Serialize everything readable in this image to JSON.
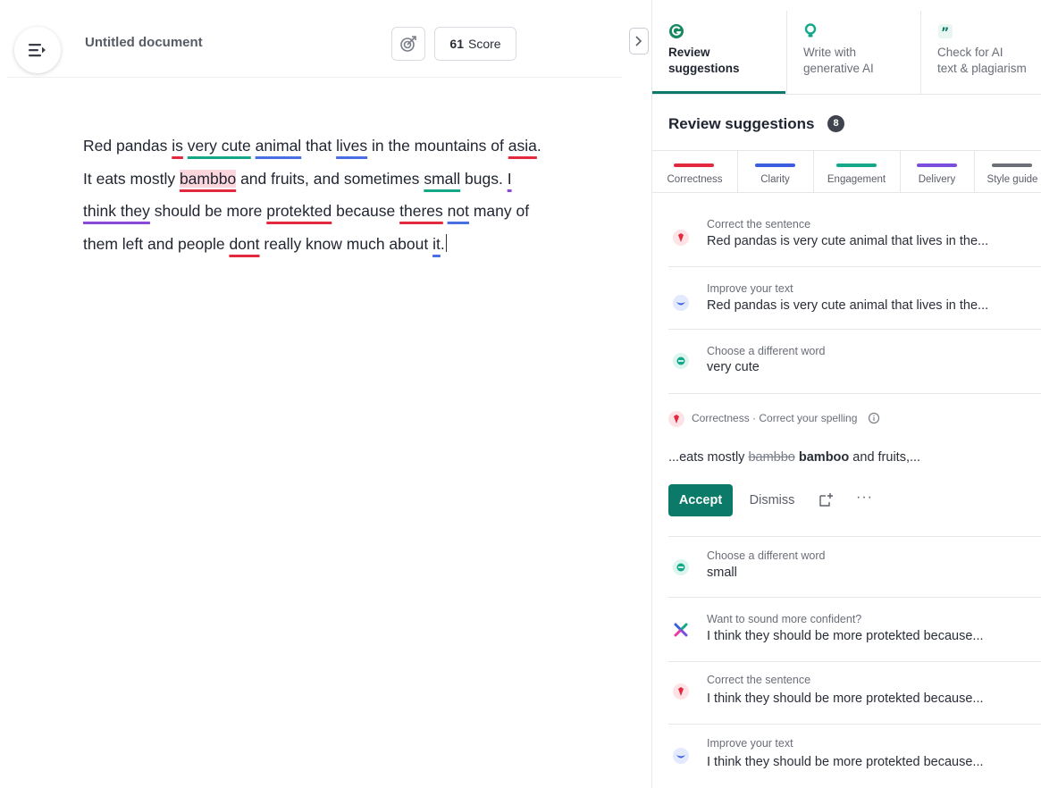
{
  "editor": {
    "doc_title": "Untitled document",
    "score": {
      "value": "61",
      "label": "Score"
    },
    "text": {
      "s1": "Red pandas ",
      "w_is": "is",
      "s2": " ",
      "w_very_cute": "very cute",
      "s3": " ",
      "w_animal": "animal",
      "s4": " that ",
      "w_lives": "lives",
      "s5": " in the mountains of ",
      "w_asia": "asia",
      "s6": ".",
      "s7": "It eats mostly ",
      "w_bambbo": "bambbo",
      "s8": " and fruits, and sometimes ",
      "w_small": "small",
      "s9": " bugs. ",
      "w_i": "I",
      "w_think_they": "think they",
      "s10": " should be more ",
      "w_protekted": "protekted",
      "s11": " because ",
      "w_theres": "theres",
      "s12": " ",
      "w_not": "not",
      "s13": " many of",
      "s14": "them left and people ",
      "w_dont": "dont",
      "s15": " really know much about ",
      "w_it": "it",
      "s16": "."
    }
  },
  "panel": {
    "tabs": [
      {
        "label": "Review\nsuggestions",
        "icon": "grammarly-g-icon"
      },
      {
        "label": "Write with\ngenerative AI",
        "icon": "lightbulb-icon"
      },
      {
        "label": "Check for AI\ntext & plagiarism",
        "icon": "quote-icon"
      }
    ],
    "header": "Review suggestions",
    "count": "8",
    "categories": [
      {
        "label": "Correctness",
        "color": "#e22a3f"
      },
      {
        "label": "Clarity",
        "color": "#3b5ee0"
      },
      {
        "label": "Engagement",
        "color": "#14a889"
      },
      {
        "label": "Delivery",
        "color": "#7c4ee0"
      },
      {
        "label": "Style guide",
        "color": "#6b6f78"
      }
    ],
    "cards": [
      {
        "title": "Correct the sentence",
        "text": "Red pandas is very cute animal that lives in the...",
        "kind": "correctness"
      },
      {
        "title": "Improve your text",
        "text": "Red pandas is very cute animal that lives in the...",
        "kind": "clarity"
      },
      {
        "title": "Choose a different word",
        "text": "very cute",
        "kind": "engagement"
      },
      {
        "title": "Choose a different word",
        "text": "small",
        "kind": "engagement"
      },
      {
        "title": "Want to sound more confident?",
        "text": "I think they should be more protekted because...",
        "kind": "delivery"
      },
      {
        "title": "Correct the sentence",
        "text": "I think they should be more protekted because...",
        "kind": "correctness"
      },
      {
        "title": "Improve your text",
        "text": "I think they should be more protekted because...",
        "kind": "clarity"
      }
    ],
    "expanded": {
      "category": "Correctness · Correct your spelling",
      "prefix": "...eats mostly ",
      "wrong": "bambbo",
      "right": "bamboo",
      "suffix": " and fruits,...",
      "accept": "Accept",
      "dismiss": "Dismiss",
      "more": "···"
    }
  }
}
